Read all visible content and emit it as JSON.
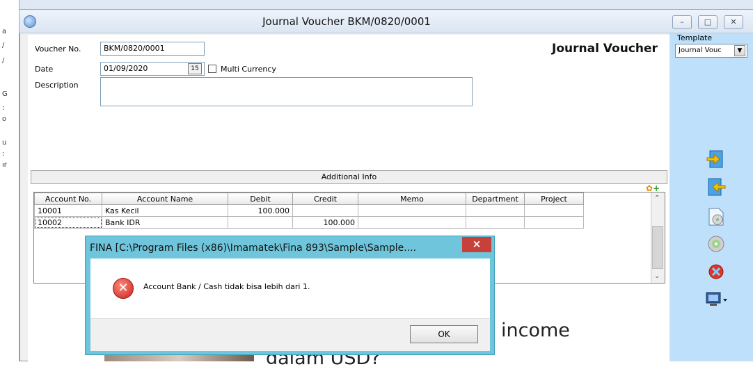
{
  "window": {
    "title": "Journal Voucher BKM/0820/0001",
    "controls": [
      "minimize",
      "maximize",
      "close"
    ]
  },
  "form": {
    "header_title": "Journal Voucher",
    "voucher_no_label": "Voucher No.",
    "voucher_no_value": "BKM/0820/0001",
    "date_label": "Date",
    "date_value": "01/09/2020",
    "multi_currency_label": "Multi Currency",
    "description_label": "Description",
    "description_value": "",
    "additional_info": "Additional Info"
  },
  "grid": {
    "columns": [
      "Account No.",
      "Account Name",
      "Debit",
      "Credit",
      "Memo",
      "Department",
      "Project"
    ],
    "rows": [
      [
        "10001",
        "Kas Kecil",
        "100.000",
        "",
        "",
        "",
        ""
      ],
      [
        "10002",
        "Bank IDR",
        "",
        "100.000",
        "",
        "",
        ""
      ]
    ]
  },
  "right_panel": {
    "template_label": "Template",
    "template_value": "Journal Vouc",
    "icons": [
      "import-icon",
      "export-icon",
      "preview-icon",
      "cd-icon",
      "delete-icon",
      "monitor-icon"
    ]
  },
  "dialog": {
    "title": "FINA  [C:\\Program Files (x86)\\Imamatek\\Fina 893\\Sample\\Sample....",
    "close_glyph": "×",
    "message": "Account Bank / Cash tidak bisa lebih dari 1.",
    "ok_label": "OK"
  },
  "background": {
    "slide_text_1": "income",
    "slide_text_2": "dalam USD?"
  },
  "colors": {
    "right_panel": "#bfe0fb",
    "dialog_frame": "#6fc6dc",
    "close_button": "#c7403a"
  }
}
